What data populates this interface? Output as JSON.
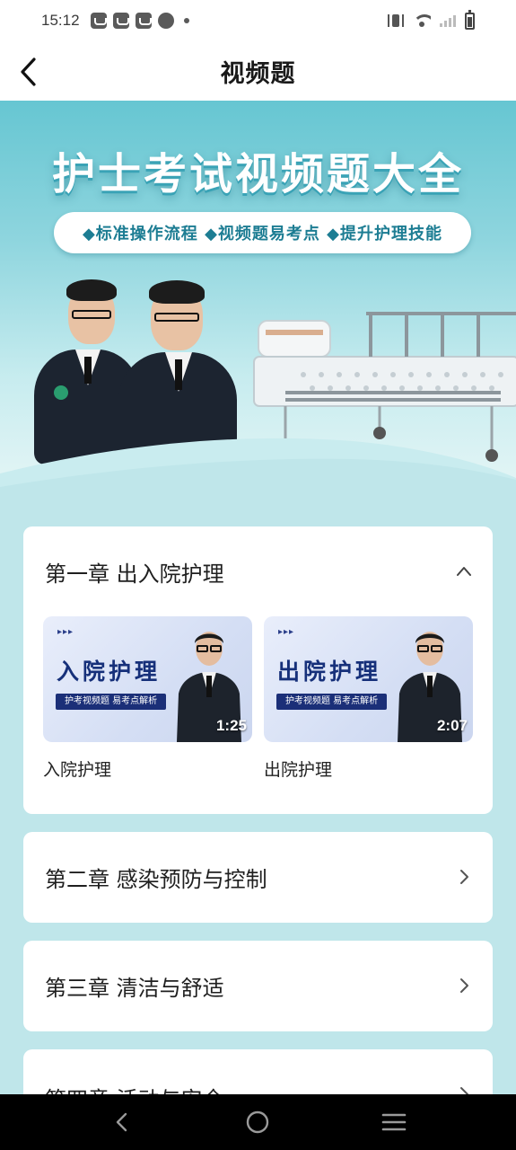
{
  "status_bar": {
    "time": "15:12",
    "left_icons": [
      "bag-icon",
      "bag-icon",
      "bag-icon",
      "gauge-icon",
      "dot-icon"
    ],
    "right_icons": [
      "vibrate-icon",
      "wifi-icon",
      "signal-icon",
      "battery-icon"
    ]
  },
  "header": {
    "title": "视频题",
    "back_icon": "chevron-left-icon"
  },
  "banner": {
    "title": "护士考试视频题大全",
    "pill": "◆标准操作流程 ◆视频题易考点 ◆提升护理技能"
  },
  "chapters": [
    {
      "title": "第一章 出入院护理",
      "expanded": true,
      "chevron": "chevron-up-icon",
      "videos": [
        {
          "thumb_title": "入院护理",
          "thumb_tag": "护考视频题  易考点解析",
          "duration": "1:25",
          "label": "入院护理"
        },
        {
          "thumb_title": "出院护理",
          "thumb_tag": "护考视频题  易考点解析",
          "duration": "2:07",
          "label": "出院护理"
        }
      ]
    },
    {
      "title": "第二章 感染预防与控制",
      "expanded": false,
      "chevron": "chevron-right-icon"
    },
    {
      "title": "第三章 清洁与舒适",
      "expanded": false,
      "chevron": "chevron-right-icon"
    },
    {
      "title": "第四章 活动与安全",
      "expanded": false,
      "chevron": "chevron-right-icon"
    }
  ],
  "nav_bar": {
    "buttons": [
      "back-nav-icon",
      "home-nav-icon",
      "menu-nav-icon"
    ]
  },
  "colors": {
    "banner_top": "#66c6d2",
    "page_bg": "#bfe6ea",
    "pill_text": "#1d7d93",
    "thumb_title": "#16307a"
  }
}
